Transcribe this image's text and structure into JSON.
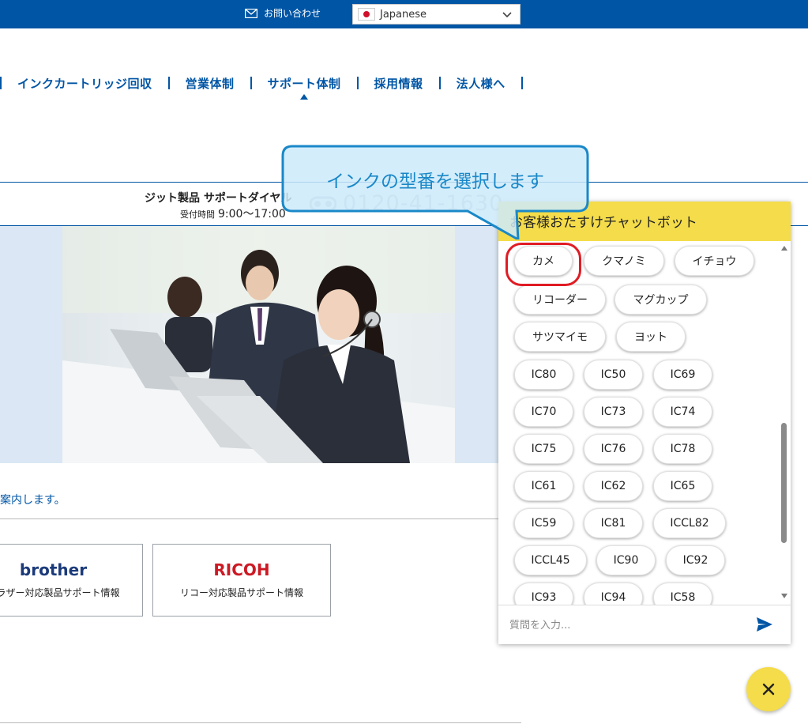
{
  "topbar": {
    "contact_label": "お問い合わせ",
    "language": "Japanese"
  },
  "nav": {
    "items": [
      "インクカートリッジ回収",
      "営業体制",
      "サポート体制",
      "採用情報",
      "法人様へ"
    ]
  },
  "support": {
    "title": "ジット製品 サポートダイヤル",
    "hours_label": "受付時間",
    "hours_value": "9:00〜17:00",
    "phone": "0120-41-1630"
  },
  "guide": {
    "text": "案内します。"
  },
  "cards": [
    {
      "brand": "brother",
      "label": "ブラザー対応製品サポート情報",
      "color": "#1b3a7a"
    },
    {
      "brand": "RICOH",
      "label": "リコー対応製品サポート情報",
      "color": "#cc1a24"
    }
  ],
  "callout": {
    "text": "インクの型番を選択します"
  },
  "chatbot": {
    "title": "お客様おたすけチャットボット",
    "options": [
      "カメ",
      "クマノミ",
      "イチョウ",
      "リコーダー",
      "マグカップ",
      "サツマイモ",
      "ヨット",
      "IC80",
      "IC50",
      "IC69",
      "IC70",
      "IC73",
      "IC74",
      "IC75",
      "IC76",
      "IC78",
      "IC61",
      "IC62",
      "IC65",
      "IC59",
      "IC81",
      "ICCL82",
      "ICCL45",
      "IC90",
      "IC92",
      "IC93",
      "IC94",
      "IC58"
    ],
    "input_placeholder": "質問を入力..."
  },
  "colors": {
    "brand_blue": "#0055a5",
    "chat_yellow": "#f4dc4a",
    "highlight_red": "#e01c24",
    "callout_blue": "#1a88c8"
  },
  "icons": {
    "contact": "mail-icon",
    "language": "japan-flag-icon",
    "send": "send-icon",
    "close": "close-icon",
    "freedial": "freedial-icon"
  }
}
